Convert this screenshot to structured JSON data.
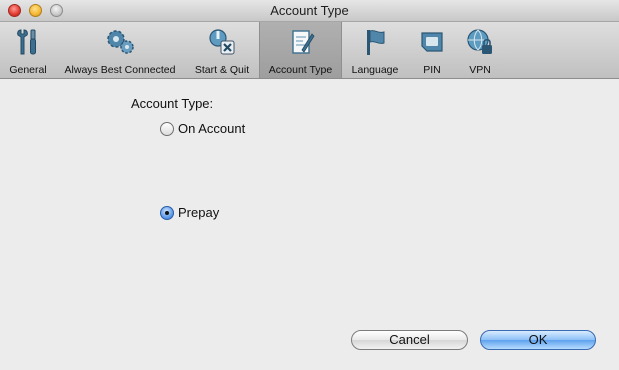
{
  "window": {
    "title": "Account Type"
  },
  "toolbar": {
    "items": [
      {
        "label": "General",
        "icon": "tools-icon",
        "selected": false
      },
      {
        "label": "Always Best Connected",
        "icon": "gears-icon",
        "selected": false
      },
      {
        "label": "Start & Quit",
        "icon": "start-quit-icon",
        "selected": false
      },
      {
        "label": "Account Type",
        "icon": "account-type-icon",
        "selected": true
      },
      {
        "label": "Language",
        "icon": "flag-icon",
        "selected": false
      },
      {
        "label": "PIN",
        "icon": "sim-card-icon",
        "selected": false
      },
      {
        "label": "VPN",
        "icon": "globe-lock-icon",
        "selected": false
      }
    ]
  },
  "content": {
    "group_label": "Account Type:",
    "options": [
      {
        "label": "On Account",
        "checked": false
      },
      {
        "label": "Prepay",
        "checked": true
      }
    ]
  },
  "buttons": {
    "cancel": "Cancel",
    "ok": "OK"
  },
  "colors": {
    "accent": "#5fa2ee",
    "selected_tab": "#a8a8a8",
    "background": "#ececec"
  }
}
